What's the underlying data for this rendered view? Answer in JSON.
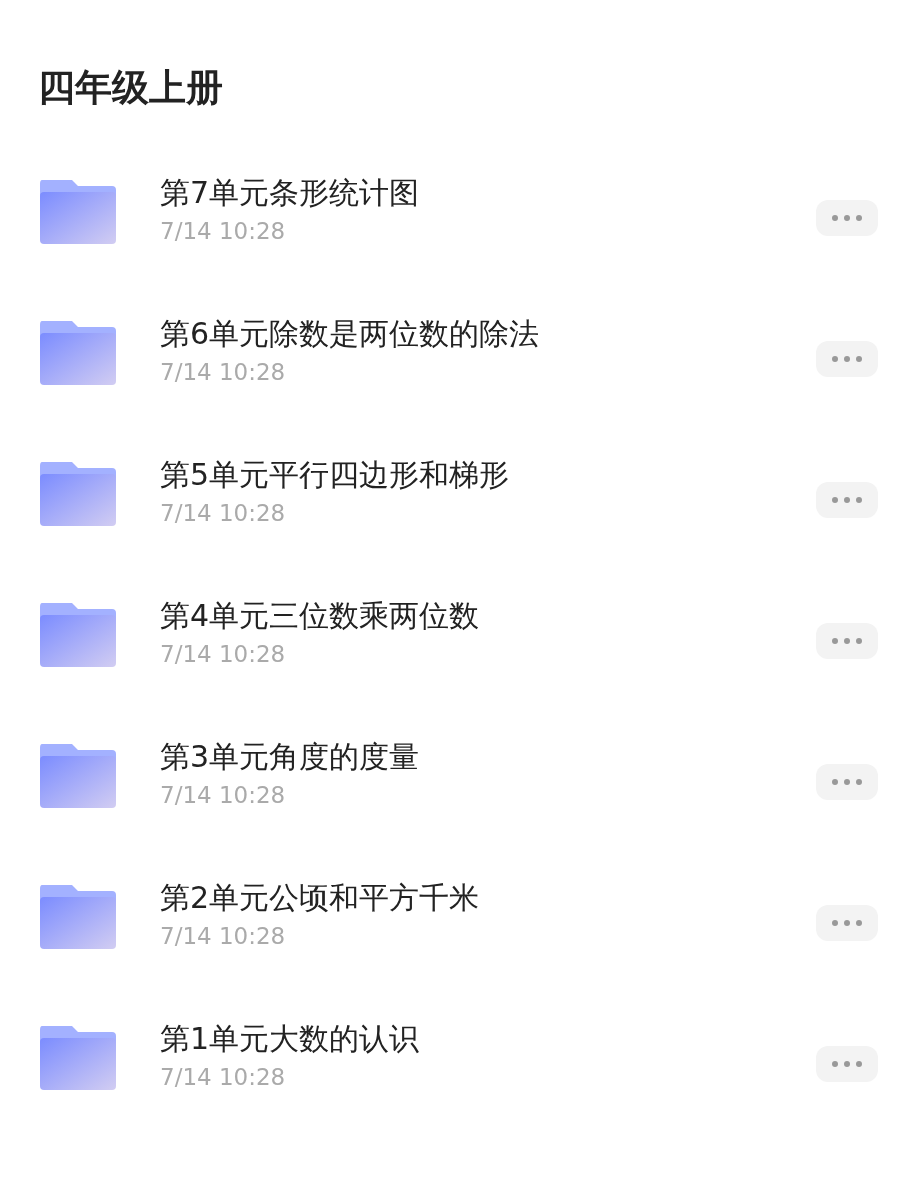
{
  "title": "四年级上册",
  "folders": [
    {
      "name": "第7单元条形统计图",
      "time": "7/14 10:28"
    },
    {
      "name": "第6单元除数是两位数的除法",
      "time": "7/14 10:28"
    },
    {
      "name": "第5单元平行四边形和梯形",
      "time": "7/14 10:28"
    },
    {
      "name": "第4单元三位数乘两位数",
      "time": "7/14 10:28"
    },
    {
      "name": "第3单元角度的度量",
      "time": "7/14 10:28"
    },
    {
      "name": "第2单元公顷和平方千米",
      "time": "7/14 10:28"
    },
    {
      "name": "第1单元大数的认识",
      "time": "7/14 10:28"
    }
  ]
}
